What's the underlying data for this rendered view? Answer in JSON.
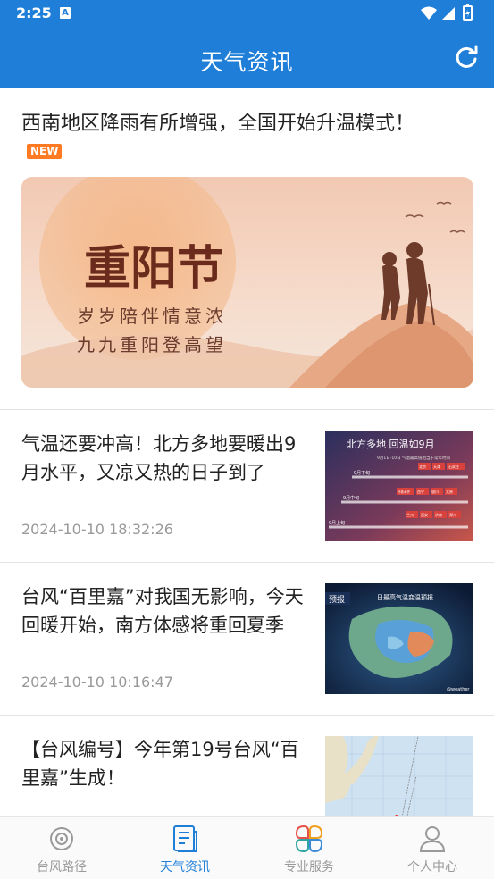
{
  "status_bar": {
    "time": "2:25",
    "notif_letter": "A"
  },
  "header": {
    "title": "天气资讯"
  },
  "hero": {
    "headline": "西南地区降雨有所增强，全国开始升温模式！",
    "badge": "NEW",
    "banner": {
      "festival": "重阳节",
      "line1": "岁岁陪伴情意浓",
      "line2": "九九重阳登高望"
    }
  },
  "news": [
    {
      "title": "气温还要冲高！北方多地要暖出9月水平，又凉又热的日子到了",
      "time": "2024-10-10 18:32:26",
      "thumb": {
        "heading": "北方多地   回温如9月",
        "sub": "9月1日-10日  气温最高值相当于常年时间",
        "rows": [
          {
            "label": "9月下旬",
            "chips": [
              "北京",
              "天津",
              "石家庄"
            ]
          },
          {
            "label": "9月中旬",
            "chips": [
              "乌鲁木齐",
              "西宁",
              "银川",
              "太原"
            ]
          },
          {
            "label": "9月上旬",
            "chips": [
              "兰州",
              "西安",
              "济南",
              "郑州"
            ]
          }
        ]
      }
    },
    {
      "title": "台风“百里嘉”对我国无影响，今天回暖开始，南方体感将重回夏季",
      "time": "2024-10-10 10:16:47",
      "thumb": {
        "tag": "预报",
        "heading": "日最高气温变温预报",
        "credit": "@weather"
      }
    },
    {
      "title": "【台风编号】今年第19号台风“百里嘉”生成！",
      "time": ""
    }
  ],
  "tabs": [
    {
      "label": "台风路径",
      "icon": "typhoon-icon",
      "active": false
    },
    {
      "label": "天气资讯",
      "icon": "news-icon",
      "active": true
    },
    {
      "label": "专业服务",
      "icon": "services-icon",
      "active": false
    },
    {
      "label": "个人中心",
      "icon": "profile-icon",
      "active": false
    }
  ],
  "colors": {
    "primary": "#1f7fd8",
    "badge": "#ff7a22",
    "muted": "#999999"
  }
}
